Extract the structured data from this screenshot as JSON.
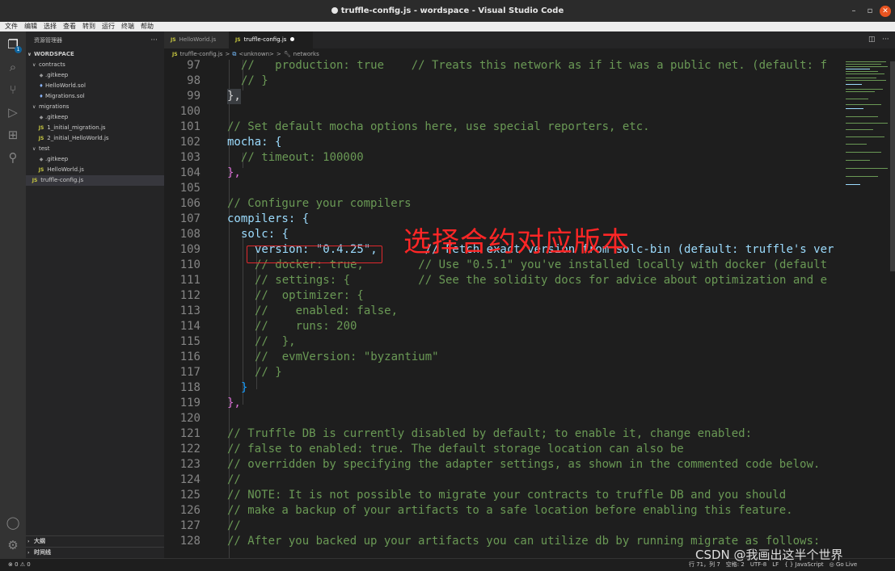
{
  "window": {
    "title": "truffle-config.js - wordspace - Visual Studio Code",
    "minimize": "–",
    "maximize": "▫",
    "close": "✕"
  },
  "menu": [
    "文件",
    "编辑",
    "选择",
    "查看",
    "转到",
    "运行",
    "终端",
    "帮助"
  ],
  "activity": {
    "badge": "1"
  },
  "explorer": {
    "header": "资源管理器",
    "more": "···",
    "root": "WORDSPACE",
    "items": [
      {
        "label": "contracts",
        "kind": "folder"
      },
      {
        "label": ".gitkeep",
        "kind": "git"
      },
      {
        "label": "HelloWorld.sol",
        "kind": "sol"
      },
      {
        "label": "Migrations.sol",
        "kind": "sol"
      },
      {
        "label": "migrations",
        "kind": "folder"
      },
      {
        "label": ".gitkeep",
        "kind": "git"
      },
      {
        "label": "1_initial_migration.js",
        "kind": "js"
      },
      {
        "label": "2_initial_HelloWorld.js",
        "kind": "js"
      },
      {
        "label": "test",
        "kind": "folder"
      },
      {
        "label": ".gitkeep",
        "kind": "git"
      },
      {
        "label": "HelloWorld.js",
        "kind": "js"
      },
      {
        "label": "truffle-config.js",
        "kind": "js-root"
      }
    ],
    "outline": "大纲",
    "timeline": "时间线"
  },
  "tabs": [
    {
      "label": "HelloWorld.js"
    },
    {
      "label": "truffle-config.js"
    }
  ],
  "breadcrumb": {
    "file": "truffle-config.js",
    "sep": ">",
    "unknown": "<unknown>",
    "symbol": "networks"
  },
  "code_lines": [
    {
      "n": "97",
      "text": "//   production: true    // Treats this network as if it was a public net. (default: f"
    },
    {
      "n": "98",
      "text": "// }"
    },
    {
      "n": "99",
      "text": "},"
    },
    {
      "n": "100",
      "text": ""
    },
    {
      "n": "101",
      "text": "// Set default mocha options here, use special reporters, etc."
    },
    {
      "n": "102",
      "text": "mocha: {"
    },
    {
      "n": "103",
      "text": "// timeout: 100000"
    },
    {
      "n": "104",
      "text": "},"
    },
    {
      "n": "105",
      "text": ""
    },
    {
      "n": "106",
      "text": "// Configure your compilers"
    },
    {
      "n": "107",
      "text": "compilers: {"
    },
    {
      "n": "108",
      "text": "solc: {"
    },
    {
      "n": "109",
      "text": "version: \"0.4.25\",       // Fetch exact version from solc-bin (default: truffle's ver"
    },
    {
      "n": "110",
      "text": "// docker: true,        // Use \"0.5.1\" you've installed locally with docker (default"
    },
    {
      "n": "111",
      "text": "// settings: {          // See the solidity docs for advice about optimization and e"
    },
    {
      "n": "112",
      "text": "//  optimizer: {"
    },
    {
      "n": "113",
      "text": "//    enabled: false,"
    },
    {
      "n": "114",
      "text": "//    runs: 200"
    },
    {
      "n": "115",
      "text": "//  },"
    },
    {
      "n": "116",
      "text": "//  evmVersion: \"byzantium\""
    },
    {
      "n": "117",
      "text": "// }"
    },
    {
      "n": "118",
      "text": "}"
    },
    {
      "n": "119",
      "text": "},"
    },
    {
      "n": "120",
      "text": ""
    },
    {
      "n": "121",
      "text": "// Truffle DB is currently disabled by default; to enable it, change enabled:"
    },
    {
      "n": "122",
      "text": "// false to enabled: true. The default storage location can also be"
    },
    {
      "n": "123",
      "text": "// overridden by specifying the adapter settings, as shown in the commented code below."
    },
    {
      "n": "124",
      "text": "//"
    },
    {
      "n": "125",
      "text": "// NOTE: It is not possible to migrate your contracts to truffle DB and you should"
    },
    {
      "n": "126",
      "text": "// make a backup of your artifacts to a safe location before enabling this feature."
    },
    {
      "n": "127",
      "text": "//"
    },
    {
      "n": "128",
      "text": "// After you backed up your artifacts you can utilize db by running migrate as follows:"
    }
  ],
  "annotation": "选择合约对应版本",
  "status": {
    "errors": "⊗ 0  ⚠ 0",
    "position": "行 71，列 7",
    "spaces": "空格: 2",
    "encoding": "UTF-8",
    "eol": "LF",
    "language": "{ } JavaScript",
    "golive": "◎ Go Live"
  },
  "watermark": "CSDN @我画出这半个世界",
  "colors": {
    "comment": "#6a9955",
    "string": "#ce9178",
    "property": "#9cdcfe",
    "highlight": "#e0292d",
    "annotation": "#ff2626"
  }
}
